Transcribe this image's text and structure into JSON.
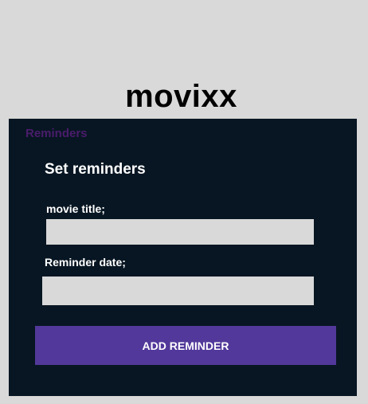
{
  "app": {
    "title": "movixx"
  },
  "panel": {
    "section_label": "Reminders",
    "heading": "Set reminders",
    "fields": {
      "movie_title": {
        "label": "movie title;",
        "value": "",
        "placeholder": ""
      },
      "reminder_date": {
        "label": "Reminder date;",
        "value": "",
        "placeholder": ""
      }
    },
    "submit_label": "ADD REMINDER"
  },
  "colors": {
    "page_background": "#d9d9d9",
    "panel_background": "#081623",
    "section_label": "#4a1c6b",
    "button_background": "#52389a",
    "input_background": "#d9d9d9"
  }
}
